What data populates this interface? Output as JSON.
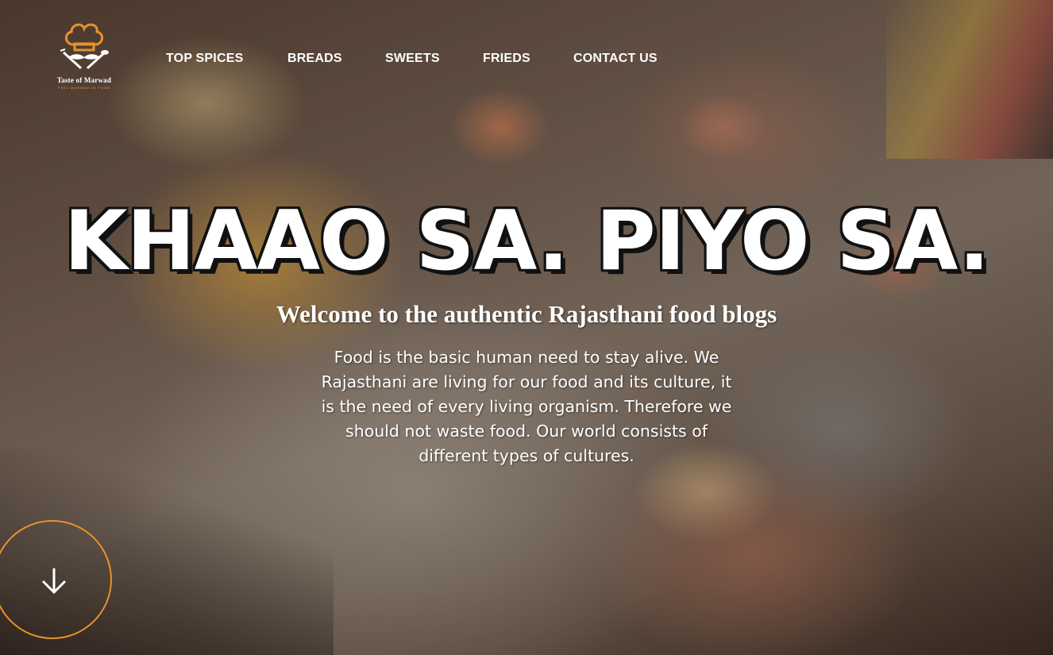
{
  "logo": {
    "name": "Taste of Marwad",
    "tagline": "FEEL MARWAD IN FOOD",
    "icon": "chef-hat-icon",
    "accent_color": "#e8922e"
  },
  "nav": {
    "items": [
      {
        "label": "TOP SPICES"
      },
      {
        "label": "BREADS"
      },
      {
        "label": "SWEETS"
      },
      {
        "label": "FRIEDS"
      },
      {
        "label": "CONTACT US"
      }
    ]
  },
  "hero": {
    "headline": "KHAAO SA. PIYO SA.",
    "subtitle": "Welcome to the authentic Rajasthani food blogs",
    "description_lines": [
      "Food is the basic human need to stay alive. We",
      "Rajasthani are living for our food and its culture, it",
      "is the need of every living organism. Therefore we",
      "should not waste food. Our world consists of",
      "different types of cultures."
    ]
  },
  "scroll_button": {
    "icon": "arrow-down-icon",
    "border_color": "#e8922e"
  }
}
